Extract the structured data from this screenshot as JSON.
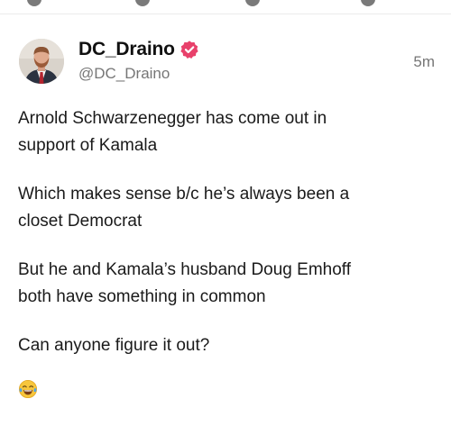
{
  "post": {
    "author": {
      "display_name": "DC_Draino",
      "handle": "@DC_Draino",
      "verified": true,
      "avatar_icon": "profile-photo",
      "verified_icon": "verified-badge-icon"
    },
    "timestamp": "5m",
    "paragraphs": [
      "Arnold Schwarzenegger has come out in\nsupport of Kamala",
      "Which makes sense b/c he’s always been a\ncloset Democrat",
      "But he and Kamala’s husband Doug Emhoff\nboth have something in common",
      "Can anyone figure it out?"
    ],
    "trailing_emoji": "face-with-tears-of-joy-icon"
  },
  "colors": {
    "verified_badge": "#e8416b",
    "secondary_text": "#767676",
    "primary_text": "#1a1a1a"
  }
}
